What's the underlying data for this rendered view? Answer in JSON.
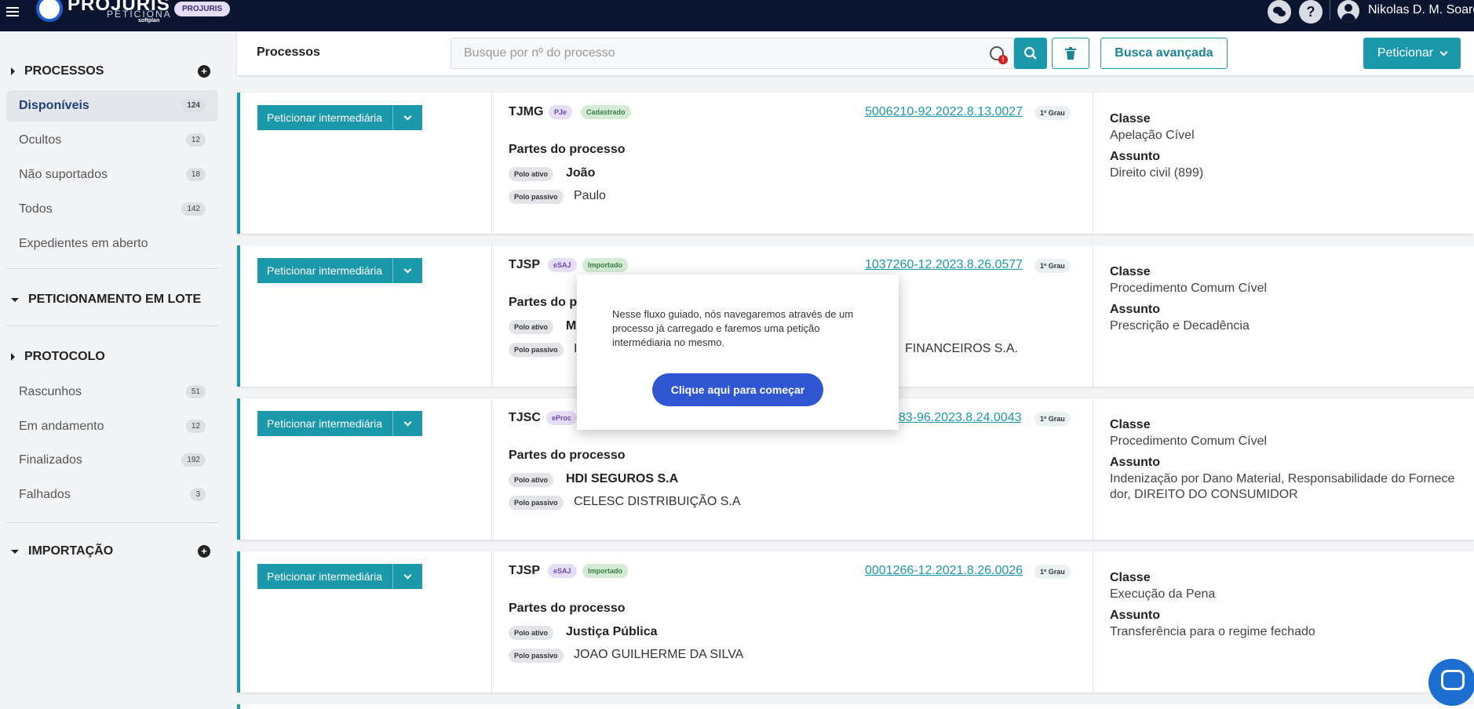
{
  "topbar": {
    "brand_name": "PROJURIS",
    "brand_sub": "PETICIONA",
    "brand_by": "softplan",
    "brand_badge": "PROJURIS",
    "user_name": "Nikolas D. M. Soares"
  },
  "sidebar": {
    "sections": [
      {
        "title": "PROCESSOS"
      },
      {
        "title": "PETICIONAMENTO EM LOTE"
      },
      {
        "title": "PROTOCOLO"
      },
      {
        "title": "IMPORTAÇÃO"
      }
    ],
    "processos_items": [
      {
        "label": "Disponíveis",
        "count": "124"
      },
      {
        "label": "Ocultos",
        "count": "12"
      },
      {
        "label": "Não suportados",
        "count": "18"
      },
      {
        "label": "Todos",
        "count": "142"
      },
      {
        "label": "Expedientes em aberto",
        "count": ""
      }
    ],
    "protocolo_items": [
      {
        "label": "Rascunhos",
        "count": "51"
      },
      {
        "label": "Em andamento",
        "count": "12"
      },
      {
        "label": "Finalizados",
        "count": "192"
      },
      {
        "label": "Falhados",
        "count": "3"
      }
    ]
  },
  "header": {
    "title": "Processos",
    "search_placeholder": "Busque por nº do processo",
    "advanced_label": "Busca avançada",
    "peticionar_label": "Peticionar"
  },
  "cards": [
    {
      "action": "Peticionar intermediária",
      "court": "TJMG",
      "system": "PJe",
      "status": "Cadastrado",
      "number": "5006210-92.2022.8.13.0027",
      "grau": "1º Grau",
      "partes_label": "Partes do processo",
      "polo_ativo_label": "Polo ativo",
      "polo_ativo": "João",
      "polo_passivo_label": "Polo passivo",
      "polo_passivo": "Paulo",
      "classe_label": "Classe",
      "classe": "Apelação Cível",
      "assunto_label": "Assunto",
      "assunto": "Direito civil (899)"
    },
    {
      "action": "Peticionar intermediária",
      "court": "TJSP",
      "system": "eSAJ",
      "status": "Importado",
      "number": "1037260-12.2023.8.26.0577",
      "grau": "1º Grau",
      "partes_label": "Partes do pr",
      "polo_ativo_label": "Polo ativo",
      "polo_ativo": "M",
      "polo_passivo_label": "Polo passivo",
      "polo_passivo": "I",
      "polo_passivo_tail": "FINANCEIROS S.A.",
      "classe_label": "Classe",
      "classe": "Procedimento Comum Cível",
      "assunto_label": "Assunto",
      "assunto": "Prescrição e Decadência"
    },
    {
      "action": "Peticionar intermediária",
      "court": "TJSC",
      "system": "eProc",
      "status": "",
      "number": "783-96.2023.8.24.0043",
      "grau": "1º Grau",
      "partes_label": "Partes do processo",
      "polo_ativo_label": "Polo ativo",
      "polo_ativo": "HDI SEGUROS S.A",
      "polo_passivo_label": "Polo passivo",
      "polo_passivo": "CELESC DISTRIBUIÇÃO S.A",
      "classe_label": "Classe",
      "classe": "Procedimento Comum Cível",
      "assunto_label": "Assunto",
      "assunto": "Indenização por Dano Material, Responsabilidade do Fornece dor, DIREITO DO CONSUMIDOR"
    },
    {
      "action": "Peticionar intermediária",
      "court": "TJSP",
      "system": "eSAJ",
      "status": "Importado",
      "number": "0001266-12.2021.8.26.0026",
      "grau": "1º Grau",
      "partes_label": "Partes do processo",
      "polo_ativo_label": "Polo ativo",
      "polo_ativo": "Justiça Pública",
      "polo_passivo_label": "Polo passivo",
      "polo_passivo": "JOAO GUILHERME DA SILVA",
      "classe_label": "Classe",
      "classe": "Execução da Pena",
      "assunto_label": "Assunto",
      "assunto": "Transferência para o regime fechado"
    }
  ],
  "modal": {
    "text": "Nesse fluxo guiado, nós navegaremos através de um processo já carregado e faremos uma petição intermédiaria no mesmo.",
    "button": "Clique aqui para começar"
  },
  "colors": {
    "topbar": "#0c1530",
    "accent": "#1b98a9",
    "modal_button": "#3056d3"
  },
  "icons": [
    "hamburger-icon",
    "chat-icon",
    "help-icon",
    "user-icon",
    "plus-icon",
    "search-icon",
    "trash-icon",
    "alert-icon",
    "chevron-down-icon"
  ]
}
